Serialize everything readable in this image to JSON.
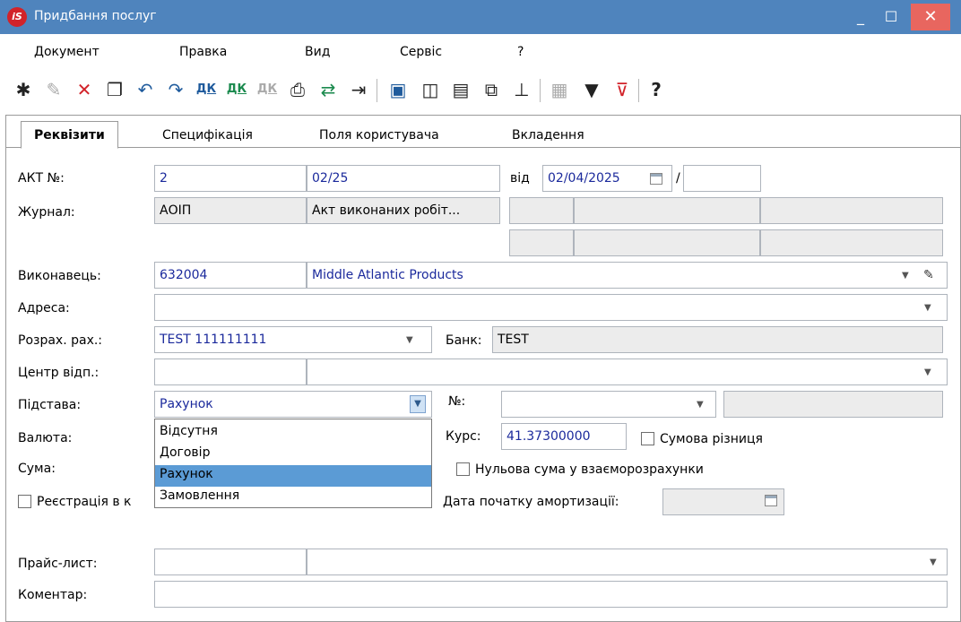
{
  "window": {
    "app_logo": "iS",
    "title": "Придбання послуг"
  },
  "menu": [
    "Документ",
    "Правка",
    "Вид",
    "Сервіс",
    "?"
  ],
  "tabs": [
    "Реквізити",
    "Специфікація",
    "Поля користувача",
    "Вкладення"
  ],
  "active_tab": "Реквізити",
  "form": {
    "act_label": "АКТ №:",
    "act_number": "2",
    "act_number2": "02/25",
    "from_label": "від",
    "date": "02/04/2025",
    "date_separator": "/",
    "journal_label": "Журнал:",
    "journal_code": "АОІП",
    "journal_name": "Акт виконаних робіт...",
    "executor_label": "Виконавець:",
    "executor_code": "632004",
    "executor_name": "Middle Atlantic Products",
    "address_label": "Адреса:",
    "account_label": "Розрах. рах.:",
    "account_value": "TEST 111111111",
    "bank_label": "Банк:",
    "bank_value": "TEST",
    "center_label": "Центр відп.:",
    "basis_label": "Підстава:",
    "basis_value": "Рахунок",
    "number_label": "№:",
    "currency_label": "Валюта:",
    "rate_label": "Курс:",
    "rate_value": "41.37300000",
    "sum_diff_label": "Сумова різниця",
    "sum_label": "Сума:",
    "zero_sum_label": "Нульова сума у взаєморозрахунки",
    "registration_label": "Реєстрація в к",
    "amort_label": "Дата початку амортизації:",
    "pricelist_label": "Прайс-лист:",
    "comment_label": "Коментар:"
  },
  "basis_options": [
    "Відсутня",
    "Договір",
    "Рахунок",
    "Замовлення"
  ],
  "basis_selected_index": 2,
  "colors": {
    "titlebar": "#4f84bd",
    "close_button": "#e8665f",
    "selected_item": "#5b9bd5",
    "value_text": "#1b2a9c"
  }
}
